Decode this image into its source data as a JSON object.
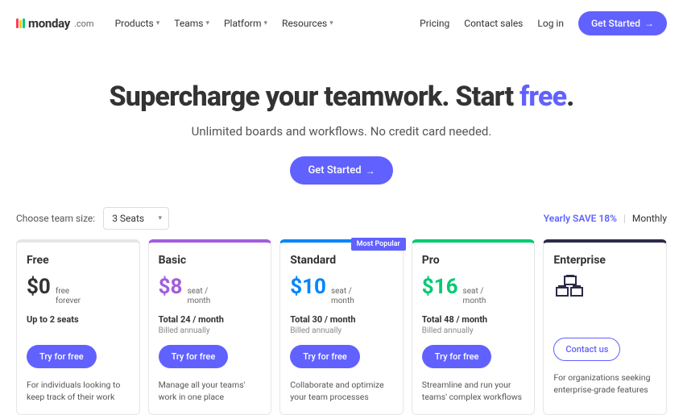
{
  "logo": {
    "name": "monday",
    "suffix": ".com"
  },
  "nav": [
    {
      "label": "Products"
    },
    {
      "label": "Teams"
    },
    {
      "label": "Platform"
    },
    {
      "label": "Resources"
    }
  ],
  "header_links": {
    "pricing": "Pricing",
    "contact": "Contact sales",
    "login": "Log in",
    "cta": "Get Started"
  },
  "hero": {
    "headline_a": "Supercharge your teamwork. Start ",
    "headline_free": "free",
    "headline_b": ".",
    "sub": "Unlimited boards and workflows. No credit card needed.",
    "cta": "Get Started"
  },
  "controls": {
    "label": "Choose team size:",
    "selected": "3 Seats"
  },
  "billing": {
    "yearly": "Yearly SAVE 18%",
    "monthly": "Monthly"
  },
  "plans": [
    {
      "key": "free",
      "name": "Free",
      "price": "$0",
      "unit1": "free",
      "unit2": "forever",
      "seats": "Up to 2 seats",
      "cta": "Try for free",
      "desc": "For individuals looking to keep track of their work"
    },
    {
      "key": "basic",
      "name": "Basic",
      "price": "$8",
      "unit1": "seat /",
      "unit2": "month",
      "total": "Total 24 / month",
      "billed": "Billed annually",
      "cta": "Try for free",
      "desc": "Manage all your teams' work in one place"
    },
    {
      "key": "standard",
      "name": "Standard",
      "price": "$10",
      "unit1": "seat /",
      "unit2": "month",
      "total": "Total 30 / month",
      "billed": "Billed annually",
      "cta": "Try for free",
      "desc": "Collaborate and optimize your team processes",
      "badge": "Most Popular"
    },
    {
      "key": "pro",
      "name": "Pro",
      "price": "$16",
      "unit1": "seat /",
      "unit2": "month",
      "total": "Total 48 / month",
      "billed": "Billed annually",
      "cta": "Try for free",
      "desc": "Streamline and run your teams' complex workflows"
    },
    {
      "key": "enterprise",
      "name": "Enterprise",
      "cta": "Contact us",
      "desc": "For organizations seeking enterprise-grade features"
    }
  ]
}
